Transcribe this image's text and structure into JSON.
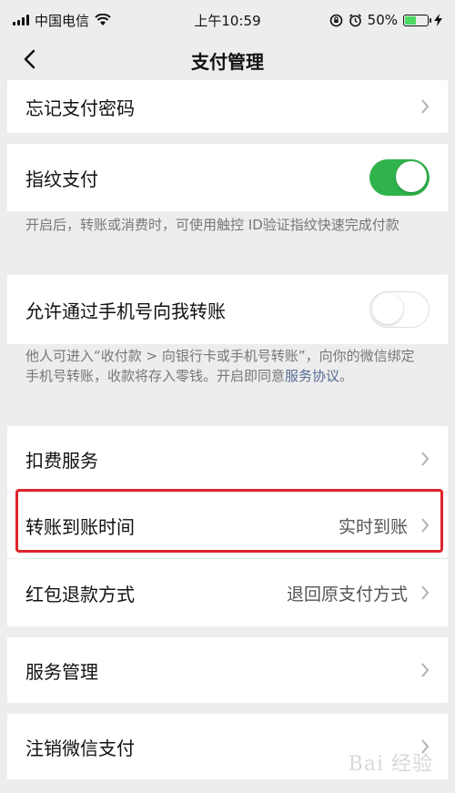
{
  "status": {
    "carrier": "中国电信",
    "time": "上午10:59",
    "battery_pct": "50%",
    "battery_level": 0.5
  },
  "nav": {
    "title": "支付管理"
  },
  "rows": {
    "forgot_password": "忘记支付密码",
    "fingerprint": "指纹支付",
    "fingerprint_on": true,
    "fingerprint_desc": "开启后，转账或消费时，可使用触控 ID验证指纹快速完成付款",
    "phone_transfer": "允许通过手机号向我转账",
    "phone_transfer_on": false,
    "phone_desc_pre": "他人可进入“收付款 > 向银行卡或手机号转账”，向你的微信绑定手机号转账，收款将存入零钱。开启即同意",
    "phone_desc_link": "服务协议",
    "phone_desc_post": "。",
    "deduct_service": "扣费服务",
    "arrival_time": "转账到账时间",
    "arrival_time_value": "实时到账",
    "red_packet_refund": "红包退款方式",
    "red_packet_refund_value": "退回原支付方式",
    "service_management": "服务管理",
    "cancel_wechat_pay": "注销微信支付"
  },
  "watermark": "Bai 经验"
}
